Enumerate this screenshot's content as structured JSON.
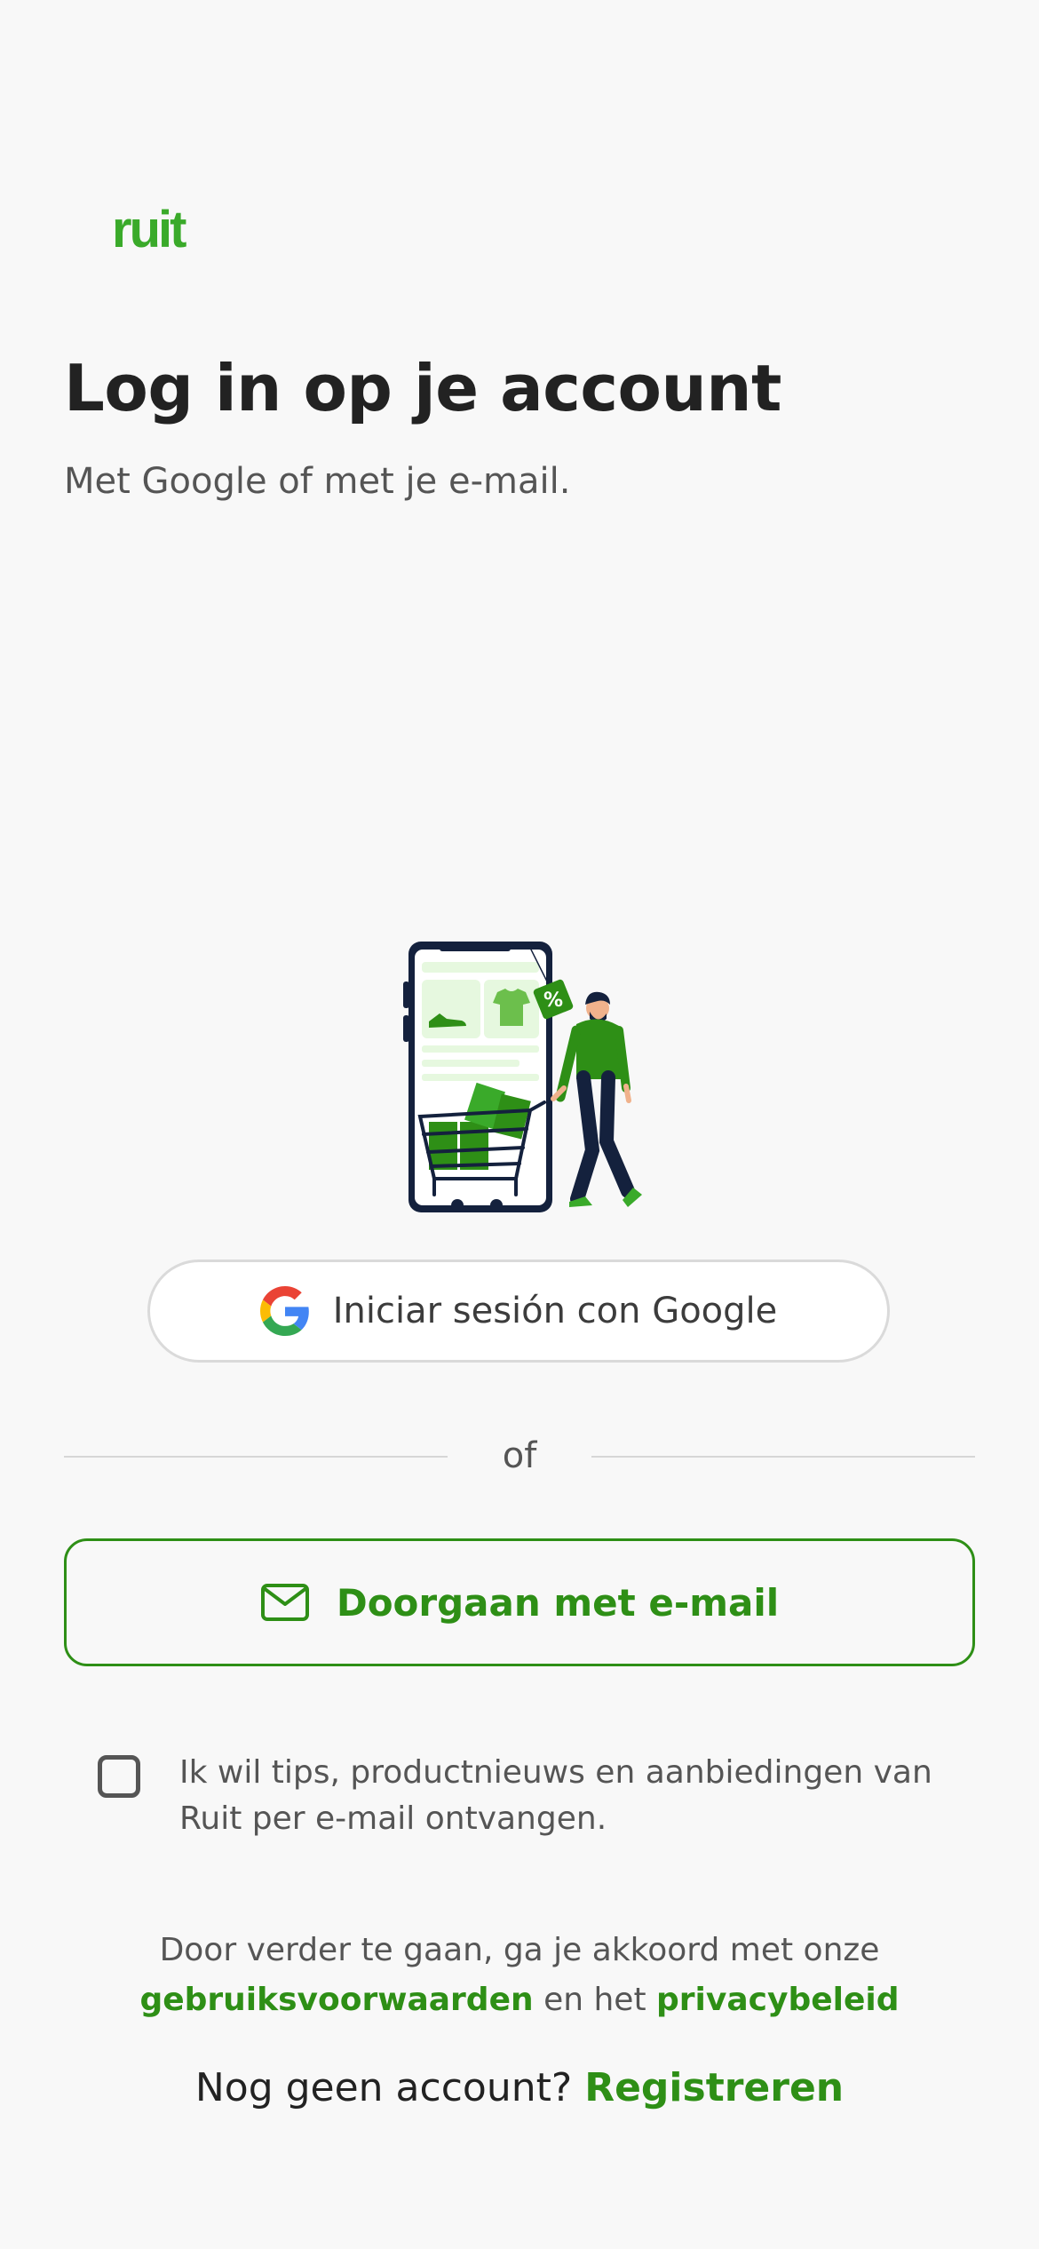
{
  "brand": {
    "logo_text": "ruit",
    "accent": "#3aaa2a",
    "primary_green": "#2e8f16"
  },
  "header": {
    "title": "Log in op je account",
    "subtitle": "Met Google of met je e-mail."
  },
  "illustration": {
    "tag_text": "%"
  },
  "google_button": {
    "label": "Iniciar sesión con Google",
    "icon": "google-g-icon"
  },
  "divider": {
    "label": "of"
  },
  "email_button": {
    "label": "Doorgaan met e-mail",
    "icon": "mail-icon"
  },
  "consent": {
    "checked": false,
    "text": "Ik wil tips, productnieuws en aanbiedingen van Ruit per e-mail ontvangen."
  },
  "terms": {
    "prefix": "Door verder te gaan, ga je akkoord met onze",
    "terms_link": "gebruiksvoorwaarden",
    "conjunction": "en het",
    "privacy_link": "privacybeleid"
  },
  "signup": {
    "prompt": "Nog geen account?",
    "link": "Registreren"
  }
}
